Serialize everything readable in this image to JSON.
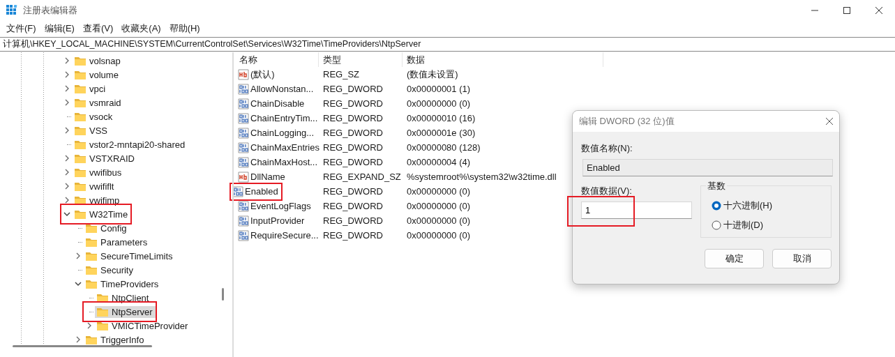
{
  "window": {
    "title": "注册表编辑器"
  },
  "menu": [
    "文件(F)",
    "编辑(E)",
    "查看(V)",
    "收藏夹(A)",
    "帮助(H)"
  ],
  "address": "计算机\\HKEY_LOCAL_MACHINE\\SYSTEM\\CurrentControlSet\\Services\\W32Time\\TimeProviders\\NtpServer",
  "tree": [
    {
      "label": "volsnap",
      "expanded": false,
      "selected": false,
      "highlighted": false
    },
    {
      "label": "volume",
      "expanded": false,
      "selected": false,
      "highlighted": false
    },
    {
      "label": "vpci",
      "expanded": false,
      "selected": false,
      "highlighted": false
    },
    {
      "label": "vsmraid",
      "expanded": false,
      "selected": false,
      "highlighted": false
    },
    {
      "label": "vsock",
      "selected": false,
      "highlighted": false
    },
    {
      "label": "VSS",
      "expanded": false,
      "selected": false,
      "highlighted": false
    },
    {
      "label": "vstor2-mntapi20-shared",
      "selected": false,
      "highlighted": false
    },
    {
      "label": "VSTXRAID",
      "expanded": false,
      "selected": false,
      "highlighted": false
    },
    {
      "label": "vwifibus",
      "expanded": false,
      "selected": false,
      "highlighted": false
    },
    {
      "label": "vwififlt",
      "expanded": false,
      "selected": false,
      "highlighted": false
    },
    {
      "label": "vwifimp",
      "expanded": false,
      "selected": false,
      "highlighted": false
    },
    {
      "label": "W32Time",
      "expanded": true,
      "selected": false,
      "highlighted": true,
      "children": [
        {
          "label": "Config",
          "selected": false,
          "highlighted": false
        },
        {
          "label": "Parameters",
          "selected": false,
          "highlighted": false
        },
        {
          "label": "SecureTimeLimits",
          "expanded": false,
          "selected": false,
          "highlighted": false
        },
        {
          "label": "Security",
          "selected": false,
          "highlighted": false
        },
        {
          "label": "TimeProviders",
          "expanded": true,
          "selected": false,
          "highlighted": false,
          "children": [
            {
              "label": "NtpClient",
              "selected": false,
              "highlighted": false
            },
            {
              "label": "NtpServer",
              "selected": true,
              "highlighted": true
            },
            {
              "label": "VMICTimeProvider",
              "expanded": false,
              "selected": false,
              "highlighted": false
            }
          ]
        },
        {
          "label": "TriggerInfo",
          "expanded": false,
          "selected": false,
          "highlighted": false
        }
      ]
    }
  ],
  "values": {
    "columns": [
      "名称",
      "类型",
      "数据"
    ],
    "rows": [
      {
        "name": "(默认)",
        "type": "REG_SZ",
        "data": "(数值未设置)",
        "kind": "string",
        "highlighted": false
      },
      {
        "name": "AllowNonstan...",
        "type": "REG_DWORD",
        "data": "0x00000001 (1)",
        "kind": "binary",
        "highlighted": false
      },
      {
        "name": "ChainDisable",
        "type": "REG_DWORD",
        "data": "0x00000000 (0)",
        "kind": "binary",
        "highlighted": false
      },
      {
        "name": "ChainEntryTim...",
        "type": "REG_DWORD",
        "data": "0x00000010 (16)",
        "kind": "binary",
        "highlighted": false
      },
      {
        "name": "ChainLogging...",
        "type": "REG_DWORD",
        "data": "0x0000001e (30)",
        "kind": "binary",
        "highlighted": false
      },
      {
        "name": "ChainMaxEntries",
        "type": "REG_DWORD",
        "data": "0x00000080 (128)",
        "kind": "binary",
        "highlighted": false
      },
      {
        "name": "ChainMaxHost...",
        "type": "REG_DWORD",
        "data": "0x00000004 (4)",
        "kind": "binary",
        "highlighted": false
      },
      {
        "name": "DllName",
        "type": "REG_EXPAND_SZ",
        "data": "%systemroot%\\system32\\w32time.dll",
        "kind": "string",
        "highlighted": false
      },
      {
        "name": "Enabled",
        "type": "REG_DWORD",
        "data": "0x00000000 (0)",
        "kind": "binary",
        "highlighted": true
      },
      {
        "name": "EventLogFlags",
        "type": "REG_DWORD",
        "data": "0x00000000 (0)",
        "kind": "binary",
        "highlighted": false
      },
      {
        "name": "InputProvider",
        "type": "REG_DWORD",
        "data": "0x00000000 (0)",
        "kind": "binary",
        "highlighted": false
      },
      {
        "name": "RequireSecure...",
        "type": "REG_DWORD",
        "data": "0x00000000 (0)",
        "kind": "binary",
        "highlighted": false
      }
    ]
  },
  "dialog": {
    "title": "编辑 DWORD (32 位)值",
    "name_label": "数值名称(N):",
    "name_value": "Enabled",
    "data_label": "数值数据(V):",
    "data_value": "1",
    "data_highlighted": true,
    "base_label": "基数",
    "bases": [
      {
        "label": "十六进制(H)",
        "selected": true
      },
      {
        "label": "十进制(D)",
        "selected": false
      }
    ],
    "buttons": [
      "确定",
      "取消"
    ]
  }
}
